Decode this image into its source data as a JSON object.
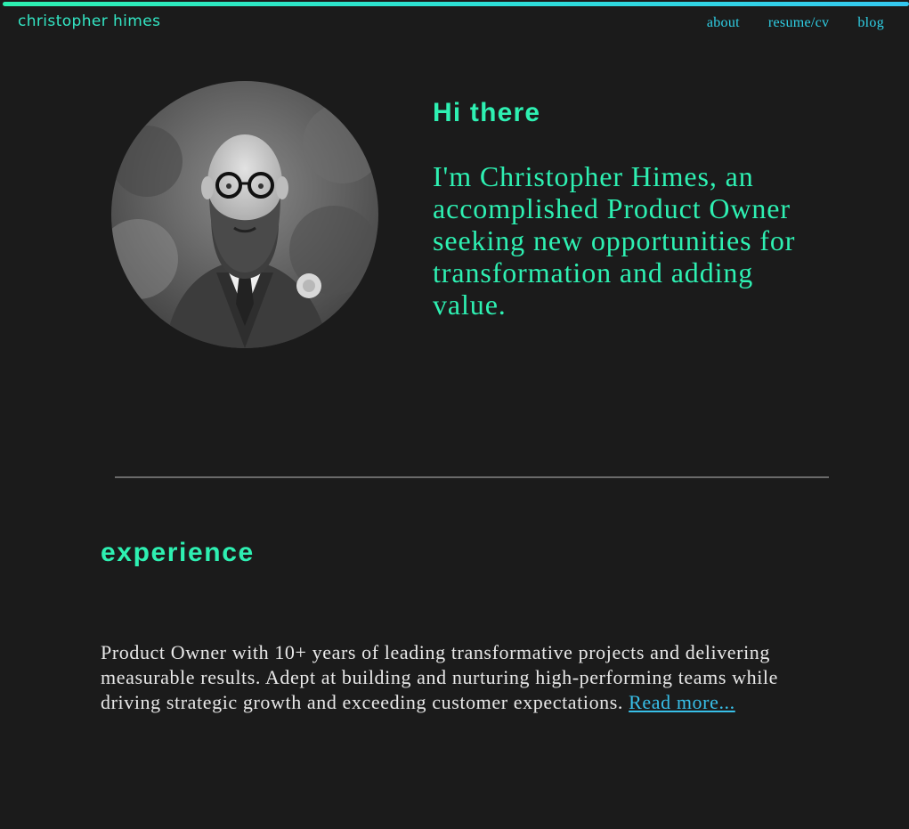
{
  "header": {
    "brand": "christopher himes",
    "nav": [
      {
        "label": "about"
      },
      {
        "label": "resume/cv"
      },
      {
        "label": "blog"
      }
    ]
  },
  "hero": {
    "heading": "Hi there",
    "intro": "I'm Christopher Himes, an accomplished Product Owner seeking new opportunities for transformation and adding value.",
    "photo_alt": "portrait photo"
  },
  "experience": {
    "title": "experience",
    "summary": "Product Owner with 10+ years of leading transformative projects and delivering measurable results. Adept at building and nurturing high-performing teams while driving strategic growth and exceeding customer expectations.",
    "read_more": "Read more..."
  },
  "colors": {
    "background": "#1b1b1b",
    "accent": "#2ef0b2",
    "link": "#2fd0e6"
  }
}
